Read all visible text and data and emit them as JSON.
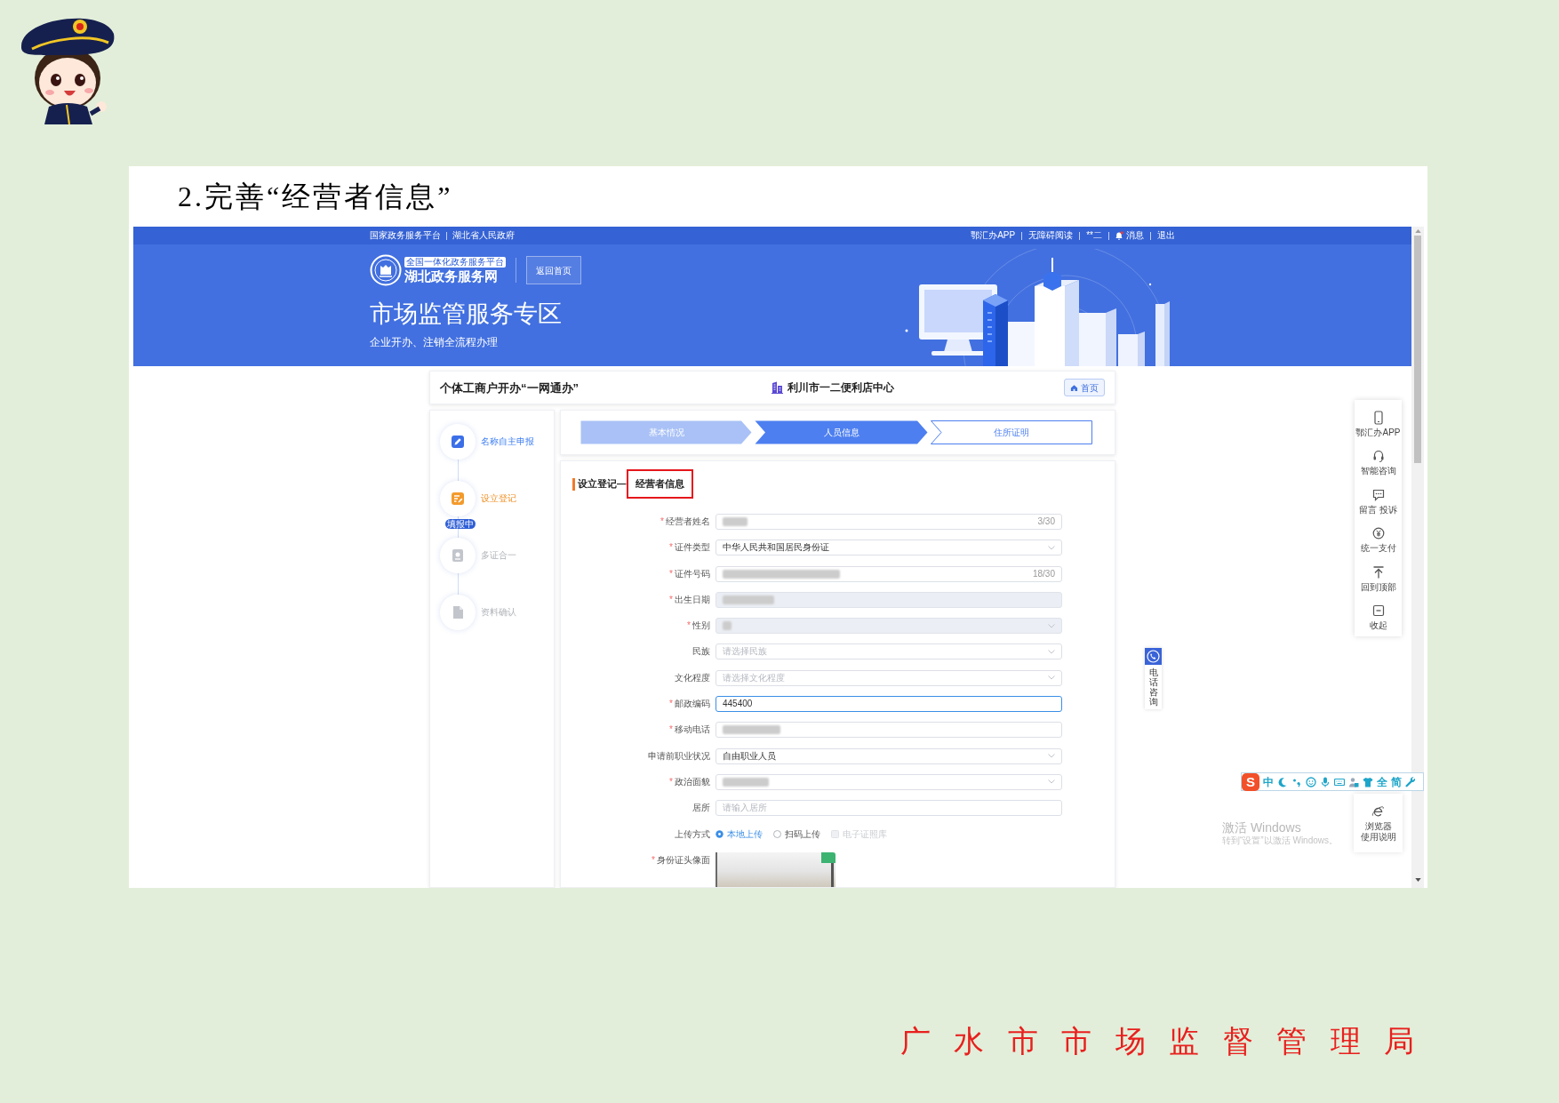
{
  "slide_title": "2.完善“经营者信息”",
  "top_bar": {
    "left": [
      "国家政务服务平台",
      "湖北省人民政府"
    ],
    "right": [
      {
        "label": "鄂汇办APP",
        "kind": "link"
      },
      {
        "label": "无障碍阅读",
        "kind": "link"
      },
      {
        "label": "**二",
        "kind": "link"
      },
      {
        "label": "消息",
        "kind": "notification"
      },
      {
        "label": "退出",
        "kind": "link"
      }
    ]
  },
  "banner": {
    "tagline": "全国一体化政务服务平台",
    "site_name": "湖北政务服务网",
    "back_button": "返回首页",
    "title": "市场监管服务专区",
    "subtitle": "企业开办、注销全流程办理"
  },
  "header": {
    "title": "个体工商户开办“一网通办”",
    "business_name": "利川市一二便利店中心",
    "home_button": "首页"
  },
  "sidebar_steps": [
    {
      "label": "名称自主申报",
      "selected": false
    },
    {
      "label": "设立登记",
      "selected": true,
      "badge": "填报中"
    },
    {
      "label": "多证合一",
      "selected": false
    },
    {
      "label": "资料确认",
      "selected": false
    }
  ],
  "progress_steps": [
    {
      "label": "基本情况",
      "selected": false
    },
    {
      "label": "人员信息",
      "selected": true
    },
    {
      "label": "住所证明",
      "selected": false
    }
  ],
  "form": {
    "title": "设立登记—",
    "highlighted_title": "经营者信息",
    "fields": [
      {
        "label": "经营者姓名",
        "required_mark": "*",
        "kind": "input",
        "redacted": true,
        "disabled": false,
        "focused": false,
        "counter": "3/30"
      },
      {
        "label": "证件类型",
        "required_mark": "*",
        "kind": "select",
        "redacted": false,
        "disabled": false,
        "focused": false,
        "value": "中华人民共和国居民身份证"
      },
      {
        "label": "证件号码",
        "required_mark": "*",
        "kind": "input",
        "redacted": true,
        "disabled": false,
        "focused": false,
        "counter": "18/30"
      },
      {
        "label": "出生日期",
        "required_mark": "*",
        "kind": "input",
        "redacted": true,
        "disabled": true,
        "focused": false
      },
      {
        "label": "性别",
        "required_mark": "*",
        "kind": "select",
        "redacted": true,
        "disabled": true,
        "focused": false
      },
      {
        "label": "民族",
        "kind": "select",
        "redacted": false,
        "disabled": false,
        "focused": false,
        "placeholder": "请选择民族"
      },
      {
        "label": "文化程度",
        "kind": "select",
        "redacted": false,
        "disabled": false,
        "focused": false,
        "placeholder": "请选择文化程度"
      },
      {
        "label": "邮政编码",
        "required_mark": "*",
        "kind": "input",
        "redacted": false,
        "disabled": false,
        "focused": true,
        "value": "445400"
      },
      {
        "label": "移动电话",
        "required_mark": "*",
        "kind": "input",
        "redacted": true,
        "disabled": false,
        "focused": false
      },
      {
        "label": "申请前职业状况",
        "kind": "select",
        "redacted": false,
        "disabled": false,
        "focused": false,
        "value": "自由职业人员"
      },
      {
        "label": "政治面貌",
        "required_mark": "*",
        "kind": "select",
        "redacted": true,
        "disabled": false,
        "focused": false
      },
      {
        "label": "居所",
        "kind": "input",
        "redacted": false,
        "disabled": false,
        "focused": false,
        "placeholder": "请输入居所"
      },
      {
        "label": "上传方式",
        "kind": "radio",
        "options": [
          {
            "label": "本地上传",
            "kind": "radio",
            "selected": true,
            "disabled": false
          },
          {
            "label": "扫码上传",
            "kind": "radio",
            "selected": false,
            "disabled": false
          },
          {
            "label": "电子证照库",
            "kind": "checkbox",
            "selected": false,
            "disabled": true
          }
        ]
      },
      {
        "label": "身份证头像面",
        "required_mark": "*",
        "kind": "upload"
      }
    ]
  },
  "side_tools": [
    "鄂汇办APP",
    "智能咨询",
    "留言 投诉",
    "统一支付",
    "回到顶部",
    "收起"
  ],
  "phone_consult": "电话咨询",
  "browser_help": [
    "浏览器",
    "使用说明"
  ],
  "windows_notice": {
    "title": "激活 Windows",
    "message": "转到“设置”以激活 Windows。"
  },
  "ime_bar": {
    "logo": "S",
    "mode": "中",
    "width": "全",
    "script": "简"
  },
  "footer": "广 水 市 市 场 监 督 管 理 局"
}
